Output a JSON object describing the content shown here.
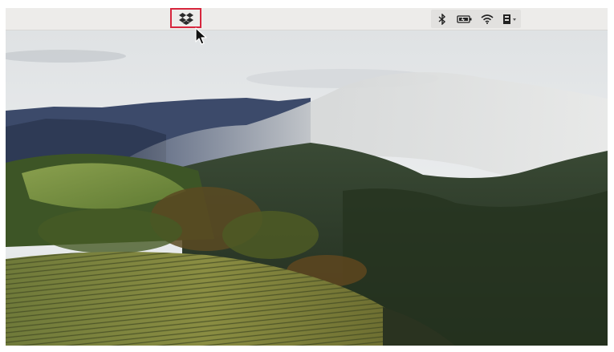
{
  "menubar": {
    "highlighted_item": "dropbox-icon",
    "tray_icons": [
      "bluetooth-icon",
      "battery-icon",
      "wifi-icon",
      "user-switch-icon"
    ]
  },
  "colors": {
    "menubar_bg": "#edecea",
    "highlight": "#d7263d"
  },
  "wallpaper": {
    "subject": "landscape"
  }
}
